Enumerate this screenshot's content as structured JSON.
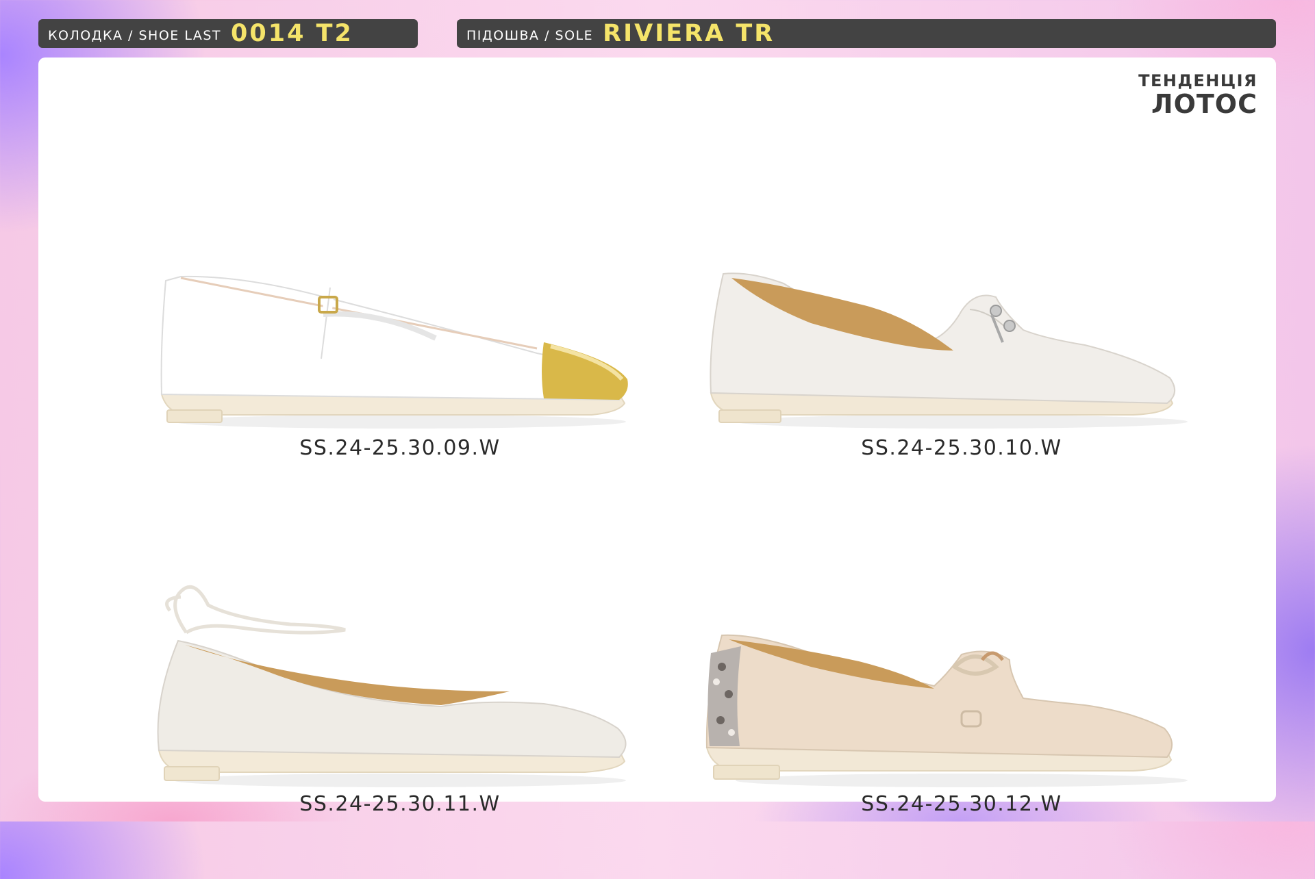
{
  "header": {
    "shoe_last_label": "КОЛОДКА / SHOE LAST",
    "shoe_last_value": "0014 T2",
    "sole_label": "ПІДОШВА / SOLE",
    "sole_value": "RIVIERA TR"
  },
  "trend": {
    "label": "ТЕНДЕНЦІЯ",
    "name": "ЛОТОС"
  },
  "products": [
    {
      "code": "SS.24-25.30.09.W"
    },
    {
      "code": "SS.24-25.30.10.W"
    },
    {
      "code": "SS.24-25.30.11.W"
    },
    {
      "code": "SS.24-25.30.12.W"
    }
  ],
  "colors": {
    "header_bg": "#434343",
    "header_value": "#f5e46a",
    "panel": "#ffffff"
  }
}
